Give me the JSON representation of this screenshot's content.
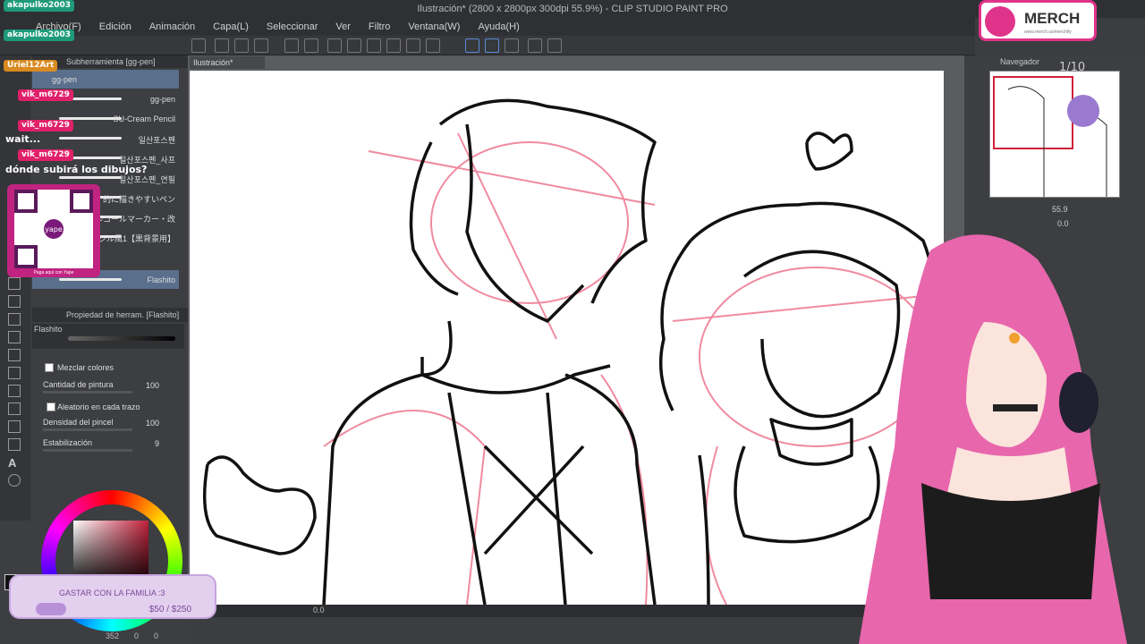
{
  "window": {
    "title": "Ilustración* (2800 x 2800px 300dpi 55.9%) - CLIP STUDIO PAINT PRO"
  },
  "menu": {
    "items": [
      "Archivo(F)",
      "Edición",
      "Animación",
      "Capa(L)",
      "Seleccionar",
      "Ver",
      "Filtro",
      "Ventana(W)",
      "Ayuda(H)"
    ]
  },
  "subtool": {
    "header": "Subherramienta [gg-pen]",
    "brushes": [
      "gg-pen",
      "gg-pen",
      "SU-Cream Pencil",
      "일산포스펜",
      "일산포스펜_사프",
      "일산포스펜_연필",
      "的に描きやすいペン",
      "アルコールマーカー・改",
      "ジル風1【黒背景用】",
      "Flashito"
    ]
  },
  "tool_property": {
    "header": "Propiedad de herram. [Flashito]",
    "brush_name": "Flashito",
    "mix_colors": "Mezclar colores",
    "paint_amount": {
      "label": "Cantidad de pintura",
      "value": "100"
    },
    "random_each": "Aleatorio en cada trazo",
    "brush_density": {
      "label": "Densidad del pincel",
      "value": "100"
    },
    "stabilization": {
      "label": "Estabilización",
      "value": "9"
    }
  },
  "canvas": {
    "tab_label": "Ilustración*"
  },
  "statusbar": {
    "zoom": "0.0",
    "coord_a": "352",
    "coord_b": "0",
    "coord_c": "0"
  },
  "navigator": {
    "header": "Navegador",
    "zoom": "55.9",
    "rotation": "0.0"
  },
  "stream": {
    "chat": [
      {
        "user": "akapulko2003",
        "color": "#1e9a7a",
        "text": ""
      },
      {
        "user": "akapulko2003",
        "color": "#1e9a7a",
        "text": ""
      },
      {
        "user": "Uriel12Art",
        "color": "#d88a20",
        "text": ""
      },
      {
        "user": "vik_m6729",
        "color": "#e0206a",
        "text": ""
      },
      {
        "user": "vik_m6729",
        "color": "#e0206a",
        "text": "wait..."
      },
      {
        "user": "vik_m6729",
        "color": "#e0206a",
        "text": "dónde subirá los dibujos?"
      }
    ],
    "qr_caption": "Paga aquí con Yape",
    "qr_brand": "yape",
    "goal": {
      "title": "GASTAR CON LA FAMILIA :3",
      "amount": "$50 / $250",
      "progress": 0.2
    },
    "merch": {
      "label": "MERCH",
      "url": "www.merch.us/merchify"
    },
    "counter": "1/10"
  },
  "colors": {
    "accent": "#5a6f8c",
    "pink": "#e0338a",
    "sketch": "#f08aa0"
  }
}
